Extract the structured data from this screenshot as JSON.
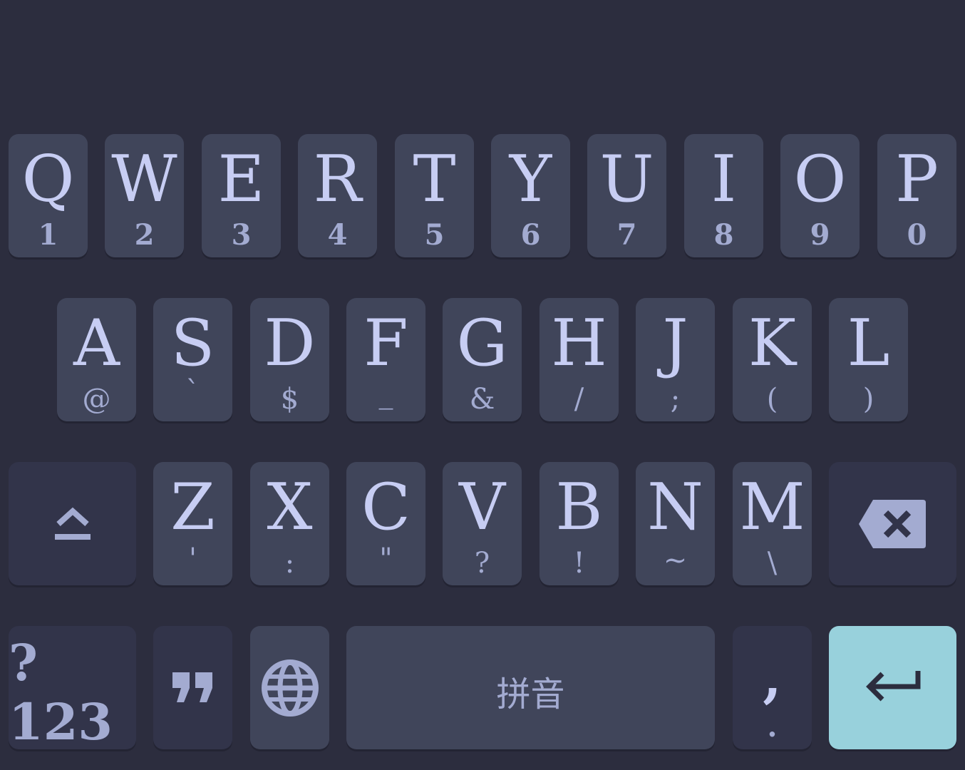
{
  "keyboard": {
    "row1": [
      {
        "main": "Q",
        "sub": "1"
      },
      {
        "main": "W",
        "sub": "2"
      },
      {
        "main": "E",
        "sub": "3"
      },
      {
        "main": "R",
        "sub": "4"
      },
      {
        "main": "T",
        "sub": "5"
      },
      {
        "main": "Y",
        "sub": "6"
      },
      {
        "main": "U",
        "sub": "7"
      },
      {
        "main": "I",
        "sub": "8"
      },
      {
        "main": "O",
        "sub": "9"
      },
      {
        "main": "P",
        "sub": "0"
      }
    ],
    "row2": [
      {
        "main": "A",
        "sub": "@"
      },
      {
        "main": "S",
        "sub": "`"
      },
      {
        "main": "D",
        "sub": "$"
      },
      {
        "main": "F",
        "sub": "_"
      },
      {
        "main": "G",
        "sub": "&"
      },
      {
        "main": "H",
        "sub": "/"
      },
      {
        "main": "J",
        "sub": ";"
      },
      {
        "main": "K",
        "sub": "("
      },
      {
        "main": "L",
        "sub": ")"
      }
    ],
    "row3": [
      {
        "main": "Z",
        "sub": "'"
      },
      {
        "main": "X",
        "sub": ":"
      },
      {
        "main": "C",
        "sub": "\""
      },
      {
        "main": "V",
        "sub": "?"
      },
      {
        "main": "B",
        "sub": "!"
      },
      {
        "main": "N",
        "sub": "~"
      },
      {
        "main": "M",
        "sub": "\\"
      }
    ],
    "row4": {
      "symbols_label": "?123",
      "space_label": "拼音",
      "comma_label": ",",
      "period_label": "."
    },
    "icons": {
      "shift": "shift-icon",
      "backspace": "backspace-icon",
      "quote": "quote-icon",
      "globe": "globe-icon",
      "enter": "enter-icon"
    },
    "colors": {
      "background": "#2c2d3e",
      "key": "#40455a",
      "key_dark": "#32344a",
      "enter": "#98d1dc",
      "label": "#c7cdf3",
      "sub_label": "#a3abd1"
    }
  }
}
